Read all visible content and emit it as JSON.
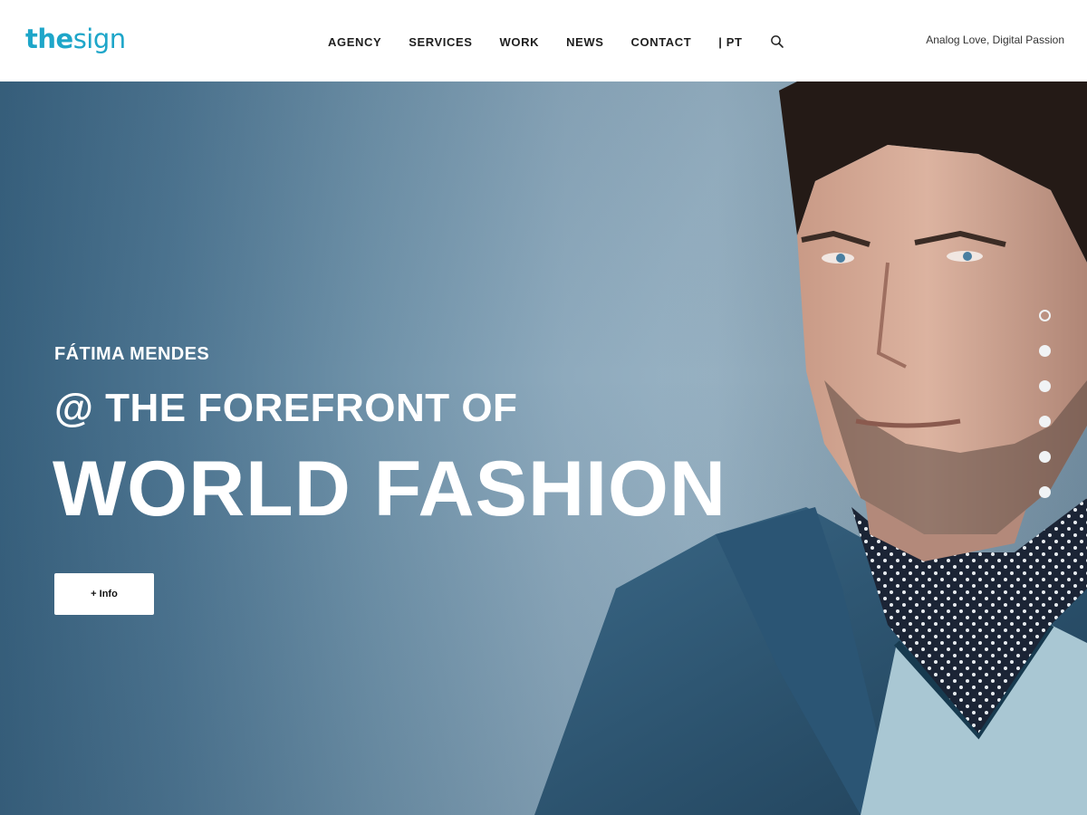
{
  "header": {
    "logo_bold": "the",
    "logo_light": "sign",
    "nav": [
      "AGENCY",
      "SERVICES",
      "WORK",
      "NEWS",
      "CONTACT"
    ],
    "lang": "| PT",
    "search_icon": "search-icon",
    "tagline": "Analog Love, Digital Passion",
    "brand_color": "#1ea6c9"
  },
  "hero": {
    "name": "FÁTIMA MENDES",
    "subtitle": "@ THE FOREFRONT OF",
    "title": "WORLD FASHION",
    "button_label": "+ Info",
    "slides_total": 6,
    "active_slide": 1
  }
}
